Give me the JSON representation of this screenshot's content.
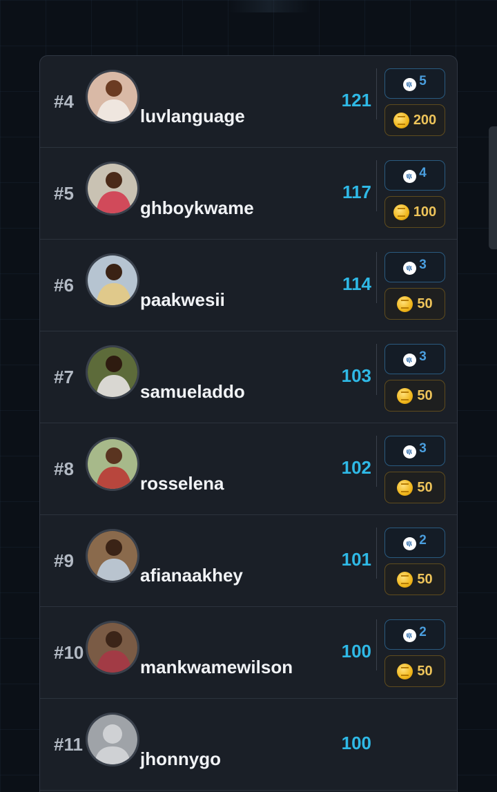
{
  "leaderboard": {
    "rows": [
      {
        "rank": "#4",
        "username": "luvlanguage",
        "score": "121",
        "steem": "5",
        "coins": "200",
        "avatar": {
          "bg": "#d9b9a6",
          "skin": "#6b3b22",
          "shirt": "#efe6df"
        }
      },
      {
        "rank": "#5",
        "username": "ghboykwame",
        "score": "117",
        "steem": "4",
        "coins": "100",
        "avatar": {
          "bg": "#c9c2b3",
          "skin": "#4a2a18",
          "shirt": "#d14a5a"
        }
      },
      {
        "rank": "#6",
        "username": "paakwesii",
        "score": "114",
        "steem": "3",
        "coins": "50",
        "avatar": {
          "bg": "#b6c4d1",
          "skin": "#3a2214",
          "shirt": "#e0c98b"
        }
      },
      {
        "rank": "#7",
        "username": "samueladdo",
        "score": "103",
        "steem": "3",
        "coins": "50",
        "avatar": {
          "bg": "#5d6b3a",
          "skin": "#2e1b10",
          "shirt": "#d9d7d2"
        }
      },
      {
        "rank": "#8",
        "username": "rosselena",
        "score": "102",
        "steem": "3",
        "coins": "50",
        "avatar": {
          "bg": "#a7b98a",
          "skin": "#5a3420",
          "shirt": "#b8463d"
        }
      },
      {
        "rank": "#9",
        "username": "afianaakhey",
        "score": "101",
        "steem": "2",
        "coins": "50",
        "avatar": {
          "bg": "#8a6a4c",
          "skin": "#3a2316",
          "shirt": "#b9c4cf"
        }
      },
      {
        "rank": "#10",
        "username": "mankwamewilson",
        "score": "100",
        "steem": "2",
        "coins": "50",
        "avatar": {
          "bg": "#7a5b45",
          "skin": "#3b2418",
          "shirt": "#a23b45"
        }
      },
      {
        "rank": "#11",
        "username": "jhonnygo",
        "score": "100",
        "steem": "",
        "coins": "",
        "avatar": {
          "bg": "#9fa3a8",
          "skin": "#cfd1d4",
          "shirt": "#cfd1d4"
        }
      }
    ]
  },
  "colors": {
    "score": "#2fb9e6",
    "steem_badge_text": "#4a9ede",
    "coin_badge_text": "#eec45a",
    "panel": "#1a1f27",
    "background": "#0b1017"
  },
  "icons": {
    "steem": "steem-logo-icon",
    "coin": "coin-icon",
    "avatar_placeholder": "default-avatar-icon"
  }
}
